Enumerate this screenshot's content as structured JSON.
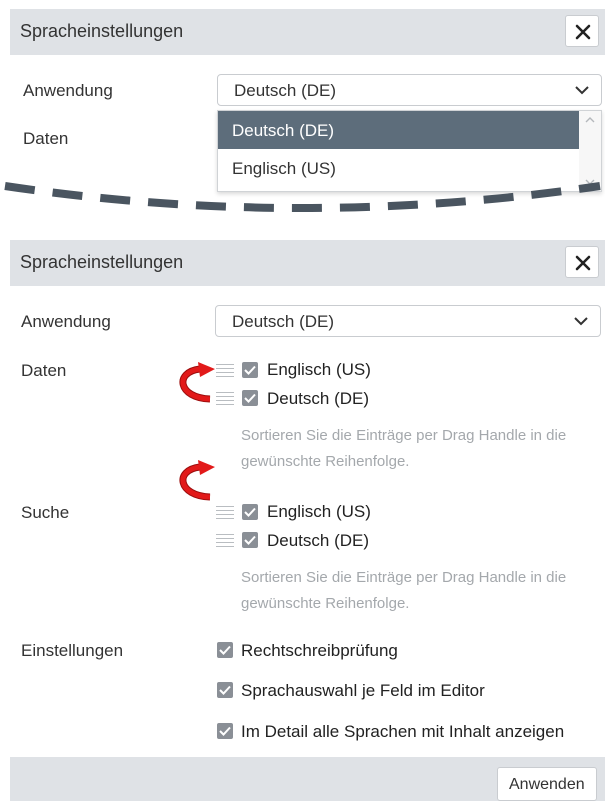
{
  "top_panel": {
    "title": "Spracheinstellungen",
    "close_icon": "close-icon",
    "application_label": "Anwendung",
    "application_value": "Deutsch (DE)",
    "data_label": "Daten",
    "dropdown_options": [
      "Deutsch (DE)",
      "Englisch (US)"
    ],
    "selected_option": "Deutsch (DE)"
  },
  "bottom_panel": {
    "title": "Spracheinstellungen",
    "application_label": "Anwendung",
    "application_value": "Deutsch (DE)",
    "data_label": "Daten",
    "data_items": [
      {
        "label": "Englisch (US)",
        "checked": true
      },
      {
        "label": "Deutsch (DE)",
        "checked": true
      }
    ],
    "data_hint": "Sortieren Sie die Einträge per Drag Handle in die gewünschte Reihenfolge.",
    "search_label": "Suche",
    "search_items": [
      {
        "label": "Englisch (US)",
        "checked": true
      },
      {
        "label": "Deutsch (DE)",
        "checked": true
      }
    ],
    "search_hint": "Sortieren Sie die Einträge per Drag Handle in die gewünschte Reihenfolge.",
    "settings_label": "Einstellungen",
    "settings_items": [
      {
        "label": "Rechtschreibprüfung",
        "checked": true
      },
      {
        "label": "Sprachauswahl je Feld im Editor",
        "checked": true
      },
      {
        "label": "Im Detail alle Sprachen mit Inhalt anzeigen",
        "checked": true
      }
    ],
    "apply_label": "Anwenden"
  },
  "colors": {
    "titlebar_bg": "#dfe2e6",
    "selected_option_bg": "#5d6d7b",
    "checkbox": "#8a8f96",
    "annotation_arrow": "#e21a1a",
    "cut_line": "#4a5560"
  }
}
